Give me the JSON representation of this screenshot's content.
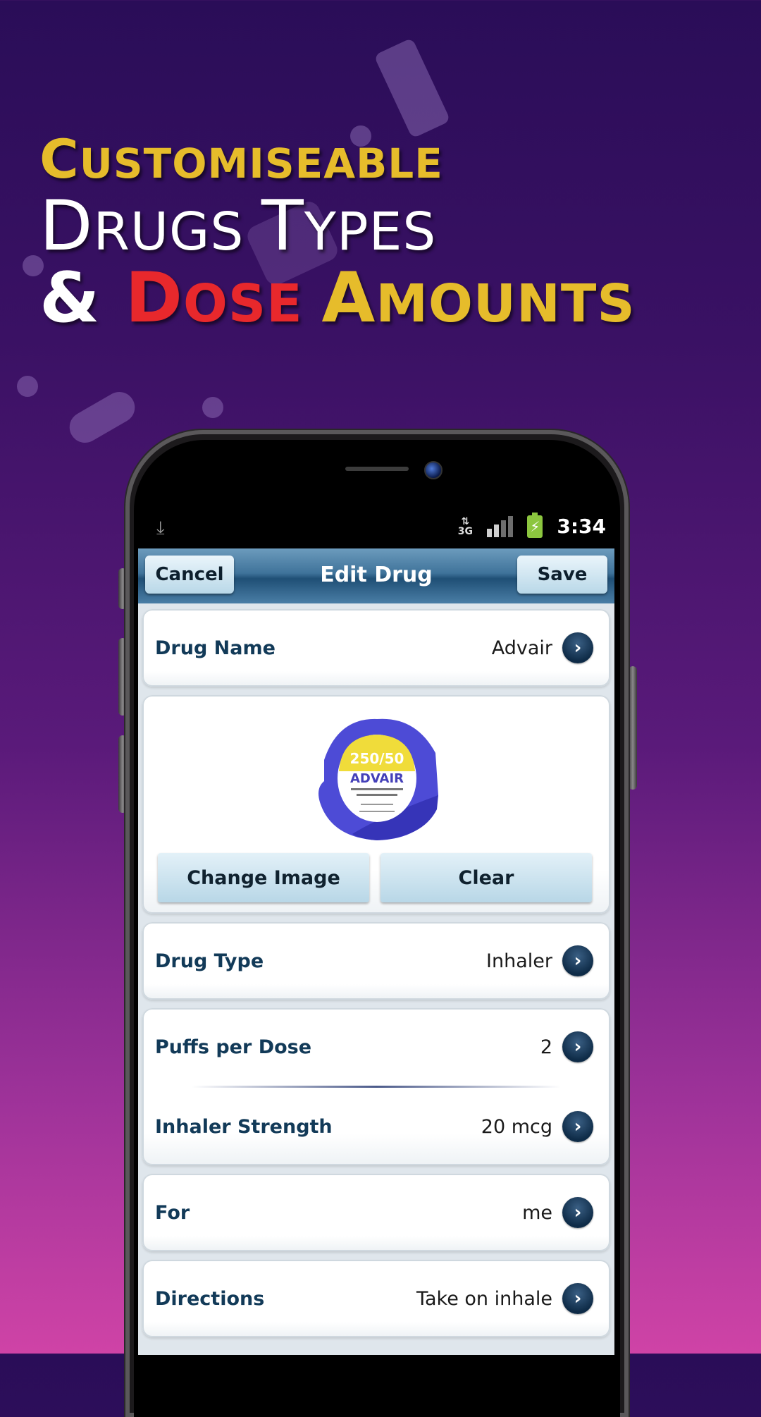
{
  "headline": {
    "line1": {
      "first": "C",
      "rest": "USTOMISEABLE"
    },
    "line2": [
      {
        "first": "D",
        "rest": "RUGS "
      },
      {
        "first": "T",
        "rest": "YPES"
      }
    ],
    "line3": [
      {
        "text": "& ",
        "color": "white"
      },
      {
        "first": "D",
        "rest": "OSE ",
        "color": "red"
      },
      {
        "first": "A",
        "rest": "MOUNTS",
        "color": "yellow"
      }
    ]
  },
  "statusbar": {
    "download_icon": "download-icon",
    "network": "3G",
    "time": "3:34"
  },
  "titlebar": {
    "cancel_label": "Cancel",
    "title": "Edit Drug",
    "save_label": "Save"
  },
  "fields": {
    "drug_name": {
      "label": "Drug Name",
      "value": "Advair"
    },
    "drug_type": {
      "label": "Drug Type",
      "value": "Inhaler"
    },
    "puffs_per_dose": {
      "label": "Puffs per Dose",
      "value": "2"
    },
    "inhaler_strength": {
      "label": "Inhaler Strength",
      "value": "20 mcg"
    },
    "for": {
      "label": "For",
      "value": "me"
    },
    "directions": {
      "label": "Directions",
      "value": "Take on inhale"
    }
  },
  "image_section": {
    "image_label": "ADVAIR",
    "image_dose": "250/50",
    "change_label": "Change Image",
    "clear_label": "Clear"
  },
  "colors": {
    "headline_yellow": "#e6bc2b",
    "headline_red": "#e8282c",
    "label_blue": "#123a58",
    "titlebar_blue": "#3f739a"
  }
}
